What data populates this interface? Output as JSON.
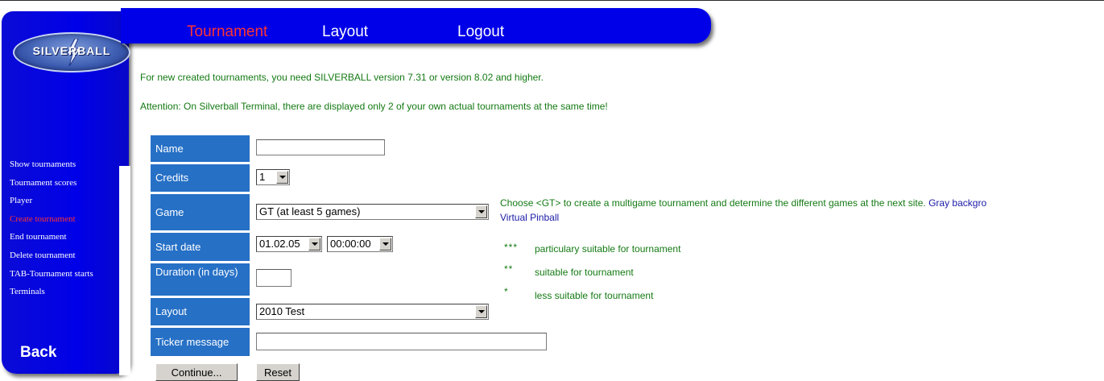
{
  "logo_text": "SILVERBALL",
  "topnav": {
    "tournament": "Tournament",
    "layout": "Layout",
    "logout": "Logout"
  },
  "sidebar": {
    "items": [
      "Show tournaments",
      "Tournament scores",
      "Player",
      "Create tournament",
      "End tournament",
      "Delete tournament",
      "TAB-Tournament starts",
      "Terminals"
    ],
    "active_index": 3,
    "back": "Back"
  },
  "info": {
    "line1": "For new created tournaments, you need SILVERBALL version 7.31 or version 8.02 and higher.",
    "line2": "Attention: On Silverball Terminal, there are displayed only 2 of your own actual tournaments at the same time!"
  },
  "form": {
    "name": {
      "label": "Name",
      "value": ""
    },
    "credits": {
      "label": "Credits",
      "value": "1"
    },
    "game": {
      "label": "Game",
      "value": "GT (at least 5 games)"
    },
    "start_date": {
      "label": "Start date",
      "date": "01.02.05",
      "time": "00:00:00"
    },
    "duration": {
      "label": "Duration (in days)",
      "value": ""
    },
    "layout": {
      "label": "Layout",
      "value": "2010 Test"
    },
    "ticker": {
      "label": "Ticker message",
      "value": ""
    }
  },
  "help": {
    "game_hint": "Choose <GT> to create a multigame tournament and determine the different games at the next site.",
    "gray_note": "Gray backgro",
    "virtual_pinball": "Virtual Pinball"
  },
  "legend": [
    {
      "stars": "***",
      "text": "particulary suitable for tournament"
    },
    {
      "stars": "**",
      "text": "suitable for tournament"
    },
    {
      "stars": "*",
      "text": "less suitable for tournament"
    }
  ],
  "buttons": {
    "continue": "Continue...",
    "reset": "Reset"
  },
  "colors": {
    "nav_blue": "#0000e8",
    "label_blue": "#2670c6",
    "info_green": "#147a14",
    "active_red": "#ff3333"
  }
}
